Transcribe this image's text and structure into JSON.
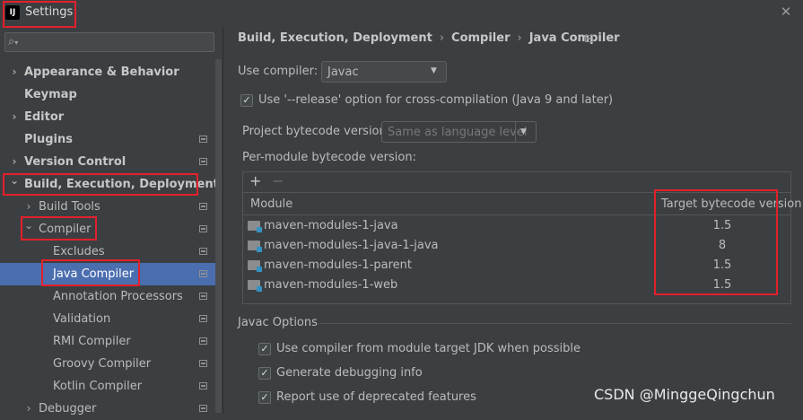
{
  "window": {
    "title": "Settings",
    "logo_text": "IJ",
    "close_glyph": "✕"
  },
  "search": {
    "icon": "search-icon"
  },
  "tree": [
    {
      "label": "Appearance & Behavior",
      "arrow": "›",
      "bold": true
    },
    {
      "label": "Keymap",
      "arrow": "",
      "bold": true
    },
    {
      "label": "Editor",
      "arrow": "›",
      "bold": true
    },
    {
      "label": "Plugins",
      "arrow": "",
      "bold": true,
      "mark": true
    },
    {
      "label": "Version Control",
      "arrow": "›",
      "bold": true,
      "mark": true
    },
    {
      "label": "Build, Execution, Deployment",
      "arrow": "⌄",
      "bold": true
    },
    {
      "label": "Build Tools",
      "arrow": "›",
      "mark": true
    },
    {
      "label": "Compiler",
      "arrow": "⌄",
      "mark": true
    },
    {
      "label": "Excludes",
      "arrow": "",
      "mark": true
    },
    {
      "label": "Java Compiler",
      "arrow": "",
      "mark": true,
      "selected": true
    },
    {
      "label": "Annotation Processors",
      "arrow": "",
      "mark": true
    },
    {
      "label": "Validation",
      "arrow": "",
      "mark": true
    },
    {
      "label": "RMI Compiler",
      "arrow": "",
      "mark": true
    },
    {
      "label": "Groovy Compiler",
      "arrow": "",
      "mark": true
    },
    {
      "label": "Kotlin Compiler",
      "arrow": "",
      "mark": true
    },
    {
      "label": "Debugger",
      "arrow": "›",
      "mark": true
    }
  ],
  "breadcrumb": {
    "part1": "Build, Execution, Deployment",
    "sep": "›",
    "part2": "Compiler",
    "part3": "Java Compiler"
  },
  "compiler": {
    "use_compiler_label": "Use compiler:",
    "selected": "Javac",
    "release_option_label": "Use '--release' option for cross-compilation (Java 9 and later)",
    "release_option_checked": true,
    "project_bytecode_label": "Project bytecode version:",
    "project_bytecode_placeholder": "Same as language level",
    "per_module_label": "Per-module bytecode version:"
  },
  "toolbar": {
    "add": "+",
    "remove": "−"
  },
  "modules_table": {
    "columns": [
      "Module",
      "Target bytecode version"
    ],
    "rows": [
      {
        "module": "maven-modules-1-java",
        "target": "1.5"
      },
      {
        "module": "maven-modules-1-java-1-java",
        "target": "8"
      },
      {
        "module": "maven-modules-1-parent",
        "target": "1.5"
      },
      {
        "module": "maven-modules-1-web",
        "target": "1.5"
      }
    ]
  },
  "javac_options": {
    "title": "Javac Options",
    "options": [
      {
        "label": "Use compiler from module target JDK when possible",
        "checked": true
      },
      {
        "label": "Generate debugging info",
        "checked": true
      },
      {
        "label": "Report use of deprecated features",
        "checked": true
      }
    ]
  },
  "check_glyph": "✓",
  "watermark": "CSDN @MinggeQingchun",
  "colors": {
    "selection": "#4b6eaf",
    "highlight_box": "#e3202b",
    "background": "#3c3f41"
  }
}
